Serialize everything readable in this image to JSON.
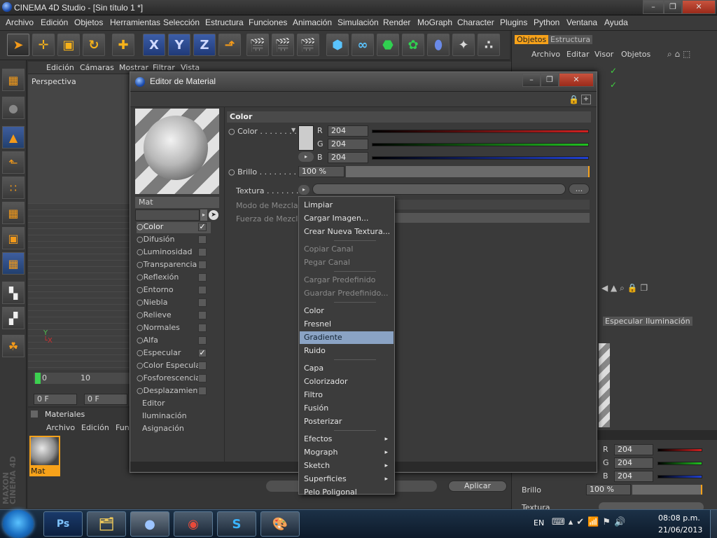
{
  "window": {
    "title": "CINEMA 4D Studio - [Sin título 1 *]"
  },
  "menubar": [
    "Archivo",
    "Edición",
    "Objetos",
    "Herramientas",
    "Selección",
    "Estructura",
    "Funciones",
    "Animación",
    "Simulación",
    "Render",
    "MoGraph",
    "Character",
    "Plugins",
    "Python",
    "Ventana",
    "Ayuda"
  ],
  "toolbar": {
    "icons": [
      "pointer-icon",
      "move-icon",
      "scale-icon",
      "rotate-icon",
      "crosshair-icon",
      "x-axis-icon",
      "y-axis-icon",
      "z-axis-icon",
      "coordinate-icon",
      "render-view-icon",
      "render-icon",
      "render-settings-icon",
      "cube-icon",
      "spline-icon",
      "nurbs-icon",
      "array-icon",
      "deformer-icon",
      "scene-icon",
      "particles-icon"
    ]
  },
  "viewport": {
    "menu": [
      "Edición",
      "Cámaras",
      "Mostrar",
      "Filtrar",
      "Vista"
    ],
    "label": "Perspectiva"
  },
  "timeline": {
    "ticks": [
      "0",
      "10"
    ],
    "frame_start": "0 F",
    "frame_current": "0 F"
  },
  "materials": {
    "title": "Materiales",
    "menu": [
      "Archivo",
      "Edición",
      "Fun"
    ],
    "items": [
      {
        "name": "Mat"
      }
    ],
    "brand": [
      "MAXON",
      "CINEMA 4D"
    ]
  },
  "right_panel": {
    "tabs": [
      "Objetos",
      "Estructura"
    ],
    "menu": [
      "Archivo",
      "Editar",
      "Visor",
      "Objetos"
    ],
    "attr_tabs": [
      "Especular",
      "Iluminación"
    ],
    "rgb": [
      {
        "c": "R",
        "v": "204"
      },
      {
        "c": "G",
        "v": "204"
      },
      {
        "c": "B",
        "v": "204"
      }
    ],
    "brillo_label": "Brillo",
    "brillo_value": "100 %",
    "texture_label": "Textura"
  },
  "material_editor": {
    "title": "Editor de Material",
    "material_name": "Mat",
    "section": "Color",
    "color_label": "Color",
    "rgb": [
      {
        "c": "R",
        "v": "204"
      },
      {
        "c": "G",
        "v": "204"
      },
      {
        "c": "B",
        "v": "204"
      }
    ],
    "brillo_label": "Brillo",
    "brillo_value": "100 %",
    "textura_label": "Textura",
    "modo_label": "Modo de Mezcla",
    "fuerza_label": "Fuerza de Mezcla",
    "textura_button": "...",
    "aplicar_label": "Aplicar",
    "channels": [
      {
        "name": "Color",
        "checked": true
      },
      {
        "name": "Difusión",
        "checked": false
      },
      {
        "name": "Luminosidad",
        "checked": false
      },
      {
        "name": "Transparencia",
        "checked": false
      },
      {
        "name": "Reflexión",
        "checked": false
      },
      {
        "name": "Entorno",
        "checked": false
      },
      {
        "name": "Niebla",
        "checked": false
      },
      {
        "name": "Relieve",
        "checked": false
      },
      {
        "name": "Normales",
        "checked": false
      },
      {
        "name": "Alfa",
        "checked": false
      },
      {
        "name": "Especular",
        "checked": true
      },
      {
        "name": "Color Especular",
        "checked": false
      },
      {
        "name": "Fosforescencia",
        "checked": false
      },
      {
        "name": "Desplazamiento",
        "checked": false
      }
    ],
    "extra": [
      "Editor",
      "Iluminación",
      "Asignación"
    ]
  },
  "context_menu": {
    "items": [
      {
        "label": "Limpiar",
        "state": "normal"
      },
      {
        "label": "Cargar Imagen...",
        "state": "normal"
      },
      {
        "label": "Crear Nueva Textura...",
        "state": "normal"
      },
      {
        "label": "Copiar Canal",
        "state": "disabled"
      },
      {
        "label": "Pegar Canal",
        "state": "disabled"
      },
      {
        "label": "Cargar Predefinido",
        "state": "disabled"
      },
      {
        "label": "Guardar Predefinido...",
        "state": "disabled"
      },
      {
        "label": "Color",
        "state": "normal"
      },
      {
        "label": "Fresnel",
        "state": "normal"
      },
      {
        "label": "Gradiente",
        "state": "highlighted"
      },
      {
        "label": "Ruido",
        "state": "normal"
      },
      {
        "label": "Capa",
        "state": "normal"
      },
      {
        "label": "Colorizador",
        "state": "normal"
      },
      {
        "label": "Filtro",
        "state": "normal"
      },
      {
        "label": "Fusión",
        "state": "normal"
      },
      {
        "label": "Posterizar",
        "state": "normal"
      },
      {
        "label": "Efectos",
        "state": "submenu"
      },
      {
        "label": "Mograph",
        "state": "submenu"
      },
      {
        "label": "Sketch",
        "state": "submenu"
      },
      {
        "label": "Superficies",
        "state": "submenu"
      },
      {
        "label": "Pelo Poligonal",
        "state": "normal"
      }
    ]
  },
  "taskbar": {
    "lang": "EN",
    "time": "08:08 p.m.",
    "date": "21/06/2013",
    "apps": [
      "windows-explorer-icon",
      "photoshop-icon",
      "cinema4d-icon",
      "chrome-icon",
      "skype-icon",
      "paint-icon"
    ]
  },
  "colors": {
    "accent_orange": "#f7a21a",
    "highlight": "#8aa3c4",
    "red": "#d02020",
    "green": "#20c020",
    "blue": "#2040d0"
  }
}
